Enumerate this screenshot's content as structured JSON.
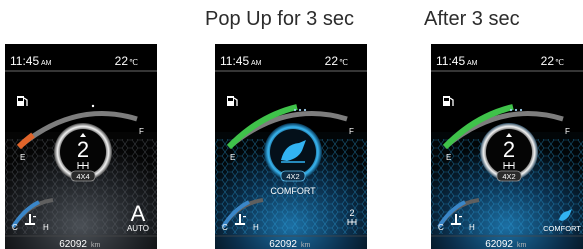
{
  "captions": {
    "popup": "Pop Up for 3 sec",
    "after": "After 3 sec"
  },
  "colors": {
    "fuel_orange": "#e0642a",
    "arc_green": "#3fc24a",
    "arc_gray": "#8a8a8a",
    "glow_blue": "#1aa3e8",
    "temp_blue": "#3a86c8",
    "bg_black": "#000000",
    "text_white": "#ffffff"
  },
  "screens": [
    {
      "time": "11:45",
      "ampm": "AM",
      "outside_temp": "22",
      "temp_unit": "℃",
      "fuel_empty": "E",
      "fuel_full": "F",
      "gear": "2",
      "drive_badge": "4X4",
      "coolant_cold": "C",
      "coolant_hot": "H",
      "mode_letter": "A",
      "mode_label": "AUTO",
      "odometer": "62092",
      "odometer_unit": "km",
      "fuel_level": 0.12,
      "icons": [
        "fuel-pump-icon",
        "gear-shift-icon",
        "coolant-thermometer-icon"
      ]
    },
    {
      "time": "11:45",
      "ampm": "AM",
      "outside_temp": "22",
      "temp_unit": "℃",
      "fuel_empty": "E",
      "fuel_full": "F",
      "drive_badge": "4X2",
      "mode_label": "COMFORT",
      "coolant_cold": "C",
      "coolant_hot": "H",
      "corner_gear": "2",
      "odometer": "62092",
      "odometer_unit": "km",
      "fuel_level": 0.5,
      "icons": [
        "fuel-pump-icon",
        "comfort-mode-icon",
        "coolant-thermometer-icon",
        "gear-shift-icon"
      ]
    },
    {
      "time": "11:45",
      "ampm": "AM",
      "outside_temp": "22",
      "temp_unit": "℃",
      "fuel_empty": "E",
      "fuel_full": "F",
      "gear": "2",
      "drive_badge": "4X2",
      "coolant_cold": "C",
      "coolant_hot": "H",
      "mode_label": "COMFORT",
      "odometer": "62092",
      "odometer_unit": "km",
      "fuel_level": 0.5,
      "icons": [
        "fuel-pump-icon",
        "gear-shift-icon",
        "coolant-thermometer-icon",
        "comfort-mode-icon"
      ]
    }
  ]
}
